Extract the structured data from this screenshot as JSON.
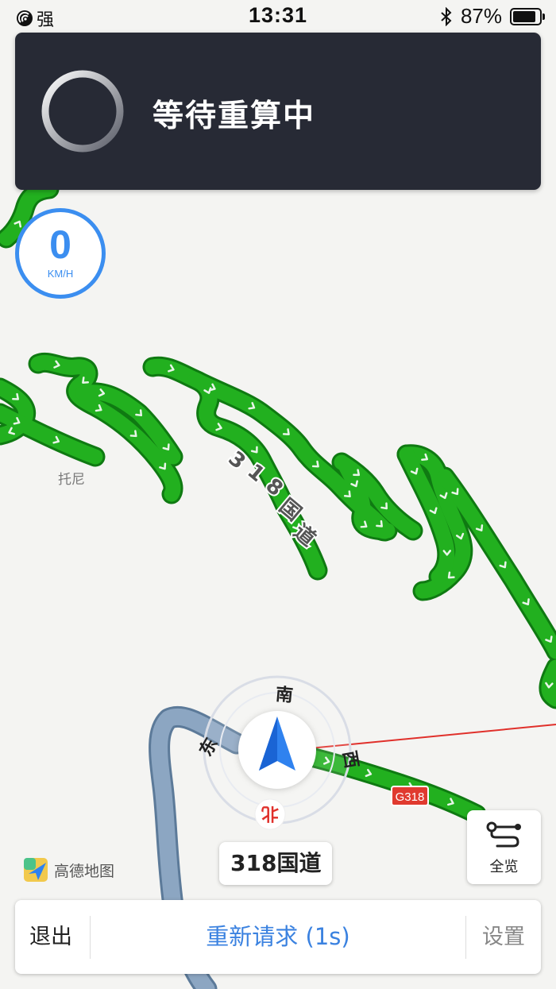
{
  "status_bar": {
    "signal_label": "强",
    "time": "13:31",
    "battery": "87%",
    "battery_level": 0.87
  },
  "banner": {
    "message": "等待重算中",
    "spinner_icon": "loading-spinner-icon"
  },
  "speedometer": {
    "value": "0",
    "unit": "KM/H"
  },
  "map": {
    "place_label": "托尼",
    "route_label": "318国道",
    "route_label_chars": [
      "3",
      "1",
      "8",
      "国",
      "道"
    ],
    "shield": "G318",
    "compass": {
      "south": "南",
      "east": "东",
      "west": "西",
      "north": "北"
    },
    "route_color": "#1fa521",
    "passed_road_color": "#7f9bb8",
    "bearing_line_color": "#e0302b"
  },
  "current_road": "318国道",
  "logo_text": "高德地图",
  "overview_button": {
    "label": "全览",
    "icon": "route-overview-icon"
  },
  "bottom_bar": {
    "exit": "退出",
    "retry": "重新请求 (1s)",
    "settings": "设置"
  },
  "colors": {
    "accent": "#3b82e0",
    "banner_bg": "#272a35"
  }
}
